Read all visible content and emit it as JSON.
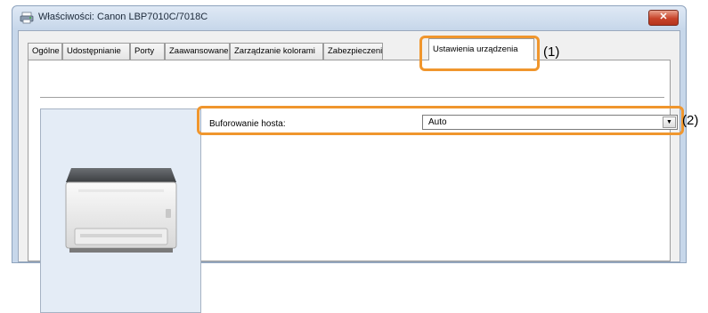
{
  "window": {
    "title": "Właściwości: Canon LBP7010C/7018C",
    "close_glyph": "✕"
  },
  "tabs": [
    {
      "label": "Ogólne"
    },
    {
      "label": "Udostępnianie"
    },
    {
      "label": "Porty"
    },
    {
      "label": "Zaawansowane"
    },
    {
      "label": "Zarządzanie kolorami"
    },
    {
      "label": "Zabezpieczeni"
    },
    {
      "label": "Ustawienia urządzenia",
      "active": true
    }
  ],
  "settings": {
    "host_buffering_label": "Buforowanie hosta:",
    "host_buffering_value": "Auto",
    "dropdown_arrow": "▼"
  },
  "callouts": {
    "label_1": "(1)",
    "label_2": "(2)"
  },
  "colors": {
    "callout": "#f0962d",
    "panel_bg": "#e4ecf6"
  },
  "icons": {
    "title_icon": "printer-icon",
    "device_image": "printer-image"
  }
}
